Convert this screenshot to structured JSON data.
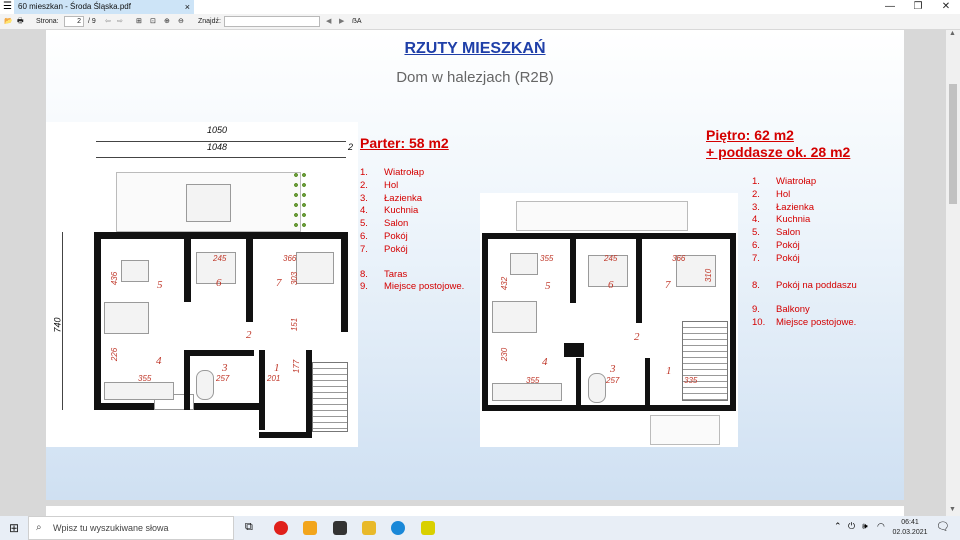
{
  "window": {
    "tab_title": "60 mieszkan - Środa Śląska.pdf",
    "tab_close": "×",
    "minimize": "—",
    "restore": "❐",
    "close": "✕"
  },
  "toolbar": {
    "page_label": "Strona:",
    "page_current": "2",
    "page_total": "/ 9",
    "find_label": "Znajdź:",
    "find_value": ""
  },
  "document": {
    "title": "RZUTY   MIESZKAŃ",
    "subtitle": "Dom w halezjach (R2B)",
    "ground": {
      "heading": "Parter: 58 m2",
      "items": [
        {
          "n": "1.",
          "label": "Wiatrołap"
        },
        {
          "n": "2.",
          "label": "Hol"
        },
        {
          "n": "3.",
          "label": "Łazienka"
        },
        {
          "n": "4.",
          "label": "Kuchnia"
        },
        {
          "n": "5.",
          "label": "Salon"
        },
        {
          "n": "6.",
          "label": "Pokój"
        },
        {
          "n": "7.",
          "label": "Pokój"
        }
      ],
      "items2": [
        {
          "n": "8.",
          "label": "Taras"
        },
        {
          "n": "9.",
          "label": "Miejsce postojowe."
        }
      ],
      "dims": {
        "top1": "1050",
        "top2": "1048",
        "top_right": "2",
        "side": "740",
        "d436": "436",
        "d245": "245",
        "d366": "366",
        "d303": "303",
        "d151": "151",
        "d226": "226",
        "d355": "355",
        "d257": "257",
        "d201": "201",
        "d177": "177"
      },
      "rooms": [
        "5",
        "6",
        "7",
        "2",
        "4",
        "3",
        "1"
      ]
    },
    "upper": {
      "heading_line1": "Piętro: 62 m2",
      "heading_line2": "+ poddasze ok. 28 m2",
      "items": [
        {
          "n": "1.",
          "label": "Wiatrołap"
        },
        {
          "n": "2.",
          "label": "Hol"
        },
        {
          "n": "3.",
          "label": "Łazienka"
        },
        {
          "n": "4.",
          "label": "Kuchnia"
        },
        {
          "n": "5.",
          "label": "Salon"
        },
        {
          "n": "6.",
          "label": "Pokój"
        },
        {
          "n": "7.",
          "label": "Pokój"
        }
      ],
      "items2": [
        {
          "n": "8.",
          "label": "Pokój na poddaszu"
        }
      ],
      "items3": [
        {
          "n": "9.",
          "label": "Balkony"
        },
        {
          "n": "10.",
          "label": "Miejsce postojowe."
        }
      ],
      "dims": {
        "d432": "432",
        "d355a": "355",
        "d245": "245",
        "d366": "366",
        "d310": "310",
        "d230": "230",
        "d355b": "355",
        "d257": "257",
        "d335": "335"
      },
      "rooms": [
        "5",
        "6",
        "7",
        "2",
        "4",
        "3",
        "1"
      ]
    }
  },
  "taskbar": {
    "search_placeholder": "Wpisz tu wyszukiwane słowa",
    "time": "06:41",
    "date": "02.03.2021"
  }
}
